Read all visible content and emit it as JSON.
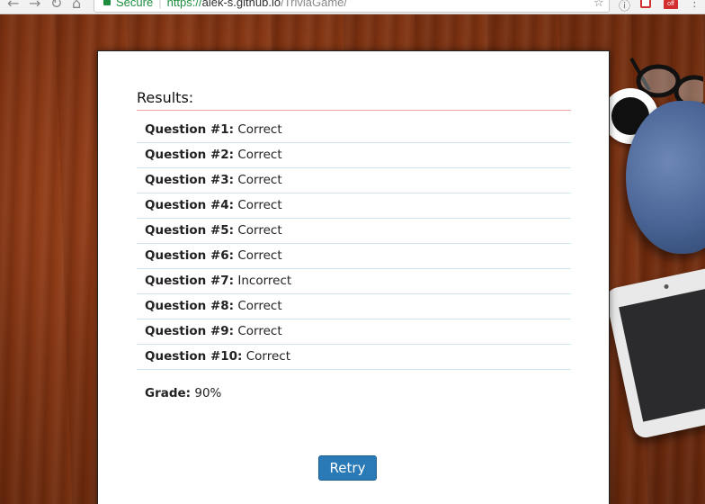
{
  "browser": {
    "secure_label": "Secure",
    "url_scheme": "https://",
    "url_host": "alek-s.github.io",
    "url_path": "/TriviaGame/",
    "ext_badge": "off",
    "icons": [
      "back-icon",
      "forward-icon",
      "reload-icon",
      "home-icon",
      "star-icon",
      "info-icon",
      "extension-icon",
      "menu-icon"
    ]
  },
  "results": {
    "title": "Results:",
    "items": [
      {
        "label": "Question #1:",
        "value": "Correct"
      },
      {
        "label": "Question #2:",
        "value": "Correct"
      },
      {
        "label": "Question #3:",
        "value": "Correct"
      },
      {
        "label": "Question #4:",
        "value": "Correct"
      },
      {
        "label": "Question #5:",
        "value": "Correct"
      },
      {
        "label": "Question #6:",
        "value": "Correct"
      },
      {
        "label": "Question #7:",
        "value": "Incorrect"
      },
      {
        "label": "Question #8:",
        "value": "Correct"
      },
      {
        "label": "Question #9:",
        "value": "Correct"
      },
      {
        "label": "Question #10:",
        "value": "Correct"
      }
    ],
    "grade_label": "Grade:",
    "grade_value": "90%",
    "retry_label": "Retry"
  },
  "colors": {
    "retry_button": "#2a7ab8",
    "title_rule": "#f0a6a6",
    "row_rule": "#cfe5f3",
    "secure_green": "#1e8e3e"
  }
}
